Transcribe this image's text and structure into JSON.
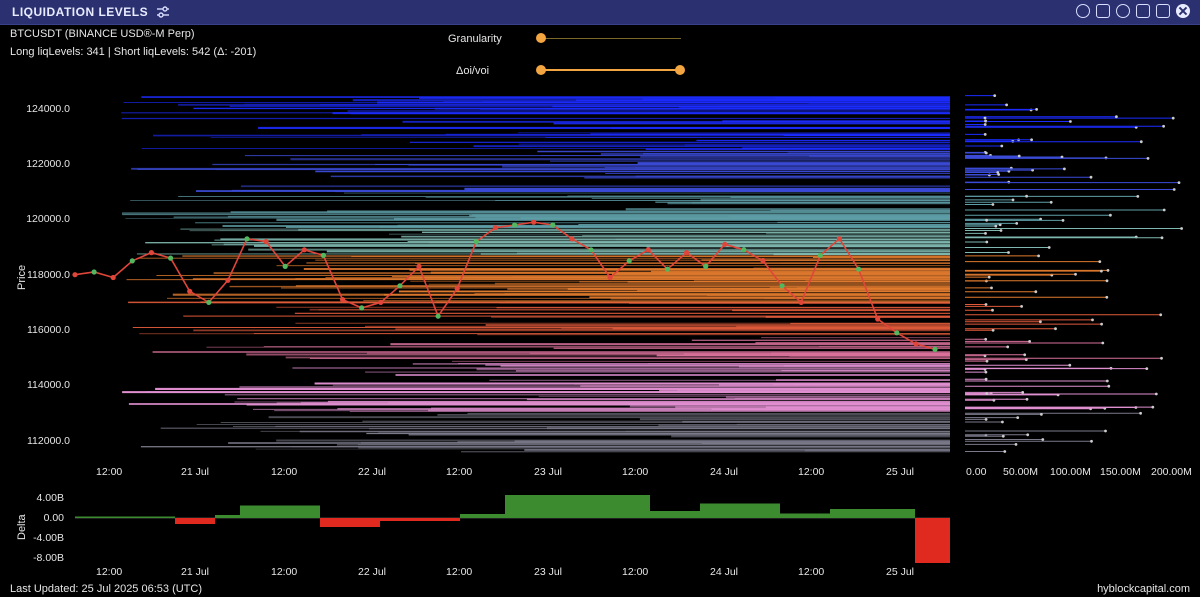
{
  "window": {
    "title": "LIQUIDATION LEVELS",
    "icons": [
      "tune-icon",
      "refresh-icon",
      "camera-icon",
      "settings-icon",
      "save-icon",
      "popout-icon",
      "close-icon"
    ]
  },
  "info": {
    "symbol": "BTCUSDT (BINANCE USD®-M Perp)",
    "levels": "Long liqLevels: 341 | Short liqLevels: 542 (Δ: -201)"
  },
  "controls": {
    "granularity_label": "Granularity",
    "oi_label": "Δoi/voi"
  },
  "chart_data": {
    "type": "line",
    "ylabel": "Price",
    "y_ticks": [
      "124000.0",
      "122000.0",
      "120000.0",
      "118000.0",
      "116000.0",
      "114000.0",
      "112000.0"
    ],
    "x_ticks": [
      "12:00",
      "21 Jul",
      "12:00",
      "22 Jul",
      "12:00",
      "23 Jul",
      "12:00",
      "24 Jul",
      "12:00",
      "25 Jul"
    ],
    "volume_ticks": [
      "0.00",
      "50.00M",
      "100.00M",
      "150.00M",
      "200.00M"
    ],
    "price_series": [
      118000,
      118100,
      117900,
      118500,
      118800,
      118600,
      117400,
      117000,
      117800,
      119300,
      119200,
      118300,
      118900,
      118700,
      117100,
      116800,
      117000,
      117600,
      118300,
      116500,
      117500,
      119200,
      119700,
      119800,
      119900,
      119800,
      119300,
      118900,
      117900,
      118500,
      118900,
      118200,
      118800,
      118300,
      119100,
      118900,
      118500,
      117600,
      117000,
      118700,
      119300,
      118200,
      116400,
      115900,
      115500,
      115300
    ],
    "delta": {
      "ylabel": "Delta",
      "y_ticks": [
        "4.00B",
        "0.00",
        "-4.00B",
        "-8.00B"
      ],
      "x_ticks": [
        "12:00",
        "21 Jul",
        "12:00",
        "22 Jul",
        "12:00",
        "23 Jul",
        "12:00",
        "24 Jul",
        "12:00",
        "25 Jul"
      ]
    }
  },
  "footer": {
    "last_updated": "Last Updated: 25 Jul 2025 06:53 (UTC)",
    "brand": "hyblockcapital.com"
  }
}
